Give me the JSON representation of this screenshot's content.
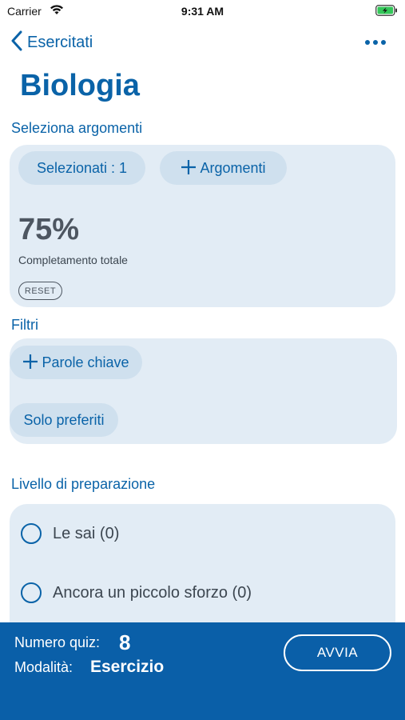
{
  "status_bar": {
    "carrier": "Carrier",
    "time": "9:31 AM"
  },
  "nav": {
    "back_label": "Esercitati"
  },
  "page_title": "Biologia",
  "topics": {
    "section_label": "Seleziona argomenti",
    "selected_label": "Selezionati : 1",
    "add_topics_label": "Argomenti",
    "completion_percent": "75%",
    "completion_label": "Completamento totale",
    "reset_label": "RESET"
  },
  "filters": {
    "section_label": "Filtri",
    "keywords_label": "Parole chiave",
    "favorites_label": "Solo preferiti"
  },
  "preparation": {
    "section_label": "Livello di preparazione",
    "options": [
      {
        "label": "Le sai (0)"
      },
      {
        "label": "Ancora un piccolo sforzo (0)"
      }
    ]
  },
  "bottom_bar": {
    "quiz_count_label": "Numero quiz:",
    "quiz_count_value": "8",
    "mode_label": "Modalità:",
    "mode_value": "Esercizio",
    "start_label": "AVVIA"
  },
  "colors": {
    "accent": "#0a63a8",
    "card": "#e2ecf5",
    "pill": "#cfe0ee",
    "bottom_bar": "#0a5fa8"
  }
}
